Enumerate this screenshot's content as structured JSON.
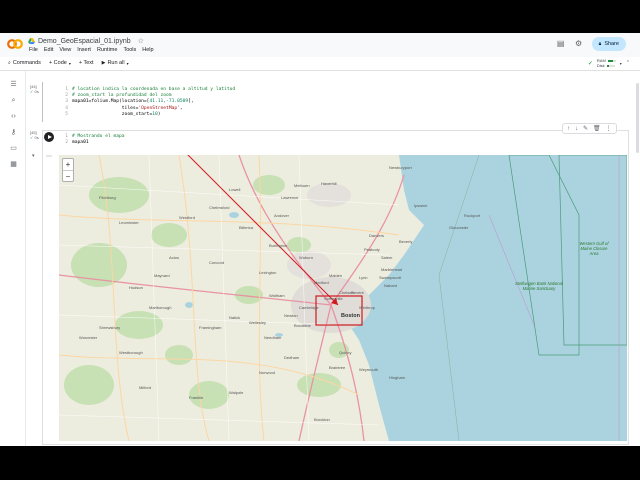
{
  "app": {
    "notebook_title": "Demo_GeoEspacial_01.ipynb",
    "menu": [
      "File",
      "Edit",
      "View",
      "Insert",
      "Runtime",
      "Tools",
      "Help"
    ],
    "share_label": "Share"
  },
  "toolbar": {
    "commands_label": "Commands",
    "code_label": "+ Code",
    "text_label": "+ Text",
    "run_all_label": "Run all",
    "ram_label": "RAM",
    "disk_label": "Disk"
  },
  "cell1": {
    "exec_count": "[44]",
    "exec_time": "0s",
    "lines": [
      {
        "n": "1",
        "parts": [
          {
            "t": "# location indica la coordenada en base a altitud y latitud",
            "c": "cm"
          }
        ]
      },
      {
        "n": "2",
        "parts": [
          {
            "t": "# zoom_start la profundidad del zoom",
            "c": "cm"
          }
        ]
      },
      {
        "n": "3",
        "parts": [
          {
            "t": "mapa01=folium.Map(location=[",
            "c": ""
          },
          {
            "t": "41.11,-71.0509",
            "c": "num"
          },
          {
            "t": "],",
            "c": ""
          }
        ]
      },
      {
        "n": "4",
        "parts": [
          {
            "t": "                  tiles=",
            "c": ""
          },
          {
            "t": "'OpenStreetMap'",
            "c": "str"
          },
          {
            "t": ",",
            "c": ""
          }
        ]
      },
      {
        "n": "5",
        "parts": [
          {
            "t": "                  zoom_start=",
            "c": ""
          },
          {
            "t": "10",
            "c": "num"
          },
          {
            "t": ")",
            "c": ""
          }
        ]
      }
    ]
  },
  "cell2": {
    "exec_count": "[45]",
    "exec_time": "0s",
    "lines": [
      {
        "n": "1",
        "parts": [
          {
            "t": "# Mostrando el mapa",
            "c": "cm"
          }
        ]
      },
      {
        "n": "2",
        "parts": [
          {
            "t": "mapa01",
            "c": ""
          }
        ]
      }
    ]
  },
  "map": {
    "zoom_in": "+",
    "zoom_out": "−",
    "places": [
      "Lowell",
      "Lawrence",
      "Haverhill",
      "Andover",
      "Methuen",
      "Newburyport",
      "Ipswich",
      "Gloucester",
      "Rockport",
      "Beverly",
      "Salem",
      "Lynn",
      "Peabody",
      "Danvers",
      "Woburn",
      "Burlington",
      "Billerica",
      "Chelmsford",
      "Westford",
      "Acton",
      "Concord",
      "Lexington",
      "Waltham",
      "Newton",
      "Framingham",
      "Natick",
      "Wellesley",
      "Needham",
      "Marlborough",
      "Hudson",
      "Maynard",
      "Fitchburg",
      "Leominster",
      "Worcester",
      "Shrewsbury",
      "Westborough",
      "Milford",
      "Franklin",
      "Walpole",
      "Norwood",
      "Dedham",
      "Quincy",
      "Braintree",
      "Weymouth",
      "Hingham",
      "Brockton",
      "Somerville",
      "Boston",
      "Cambridge",
      "Medford",
      "Malden",
      "Revere",
      "Winthrop",
      "Chelsea",
      "Brookline",
      "Nahant",
      "Marblehead",
      "Swampscott"
    ],
    "sanctuary_label": "Stellwagen Bank National Marine Sanctuary",
    "closure_label": "Western Gulf of Maine Closure Area"
  }
}
